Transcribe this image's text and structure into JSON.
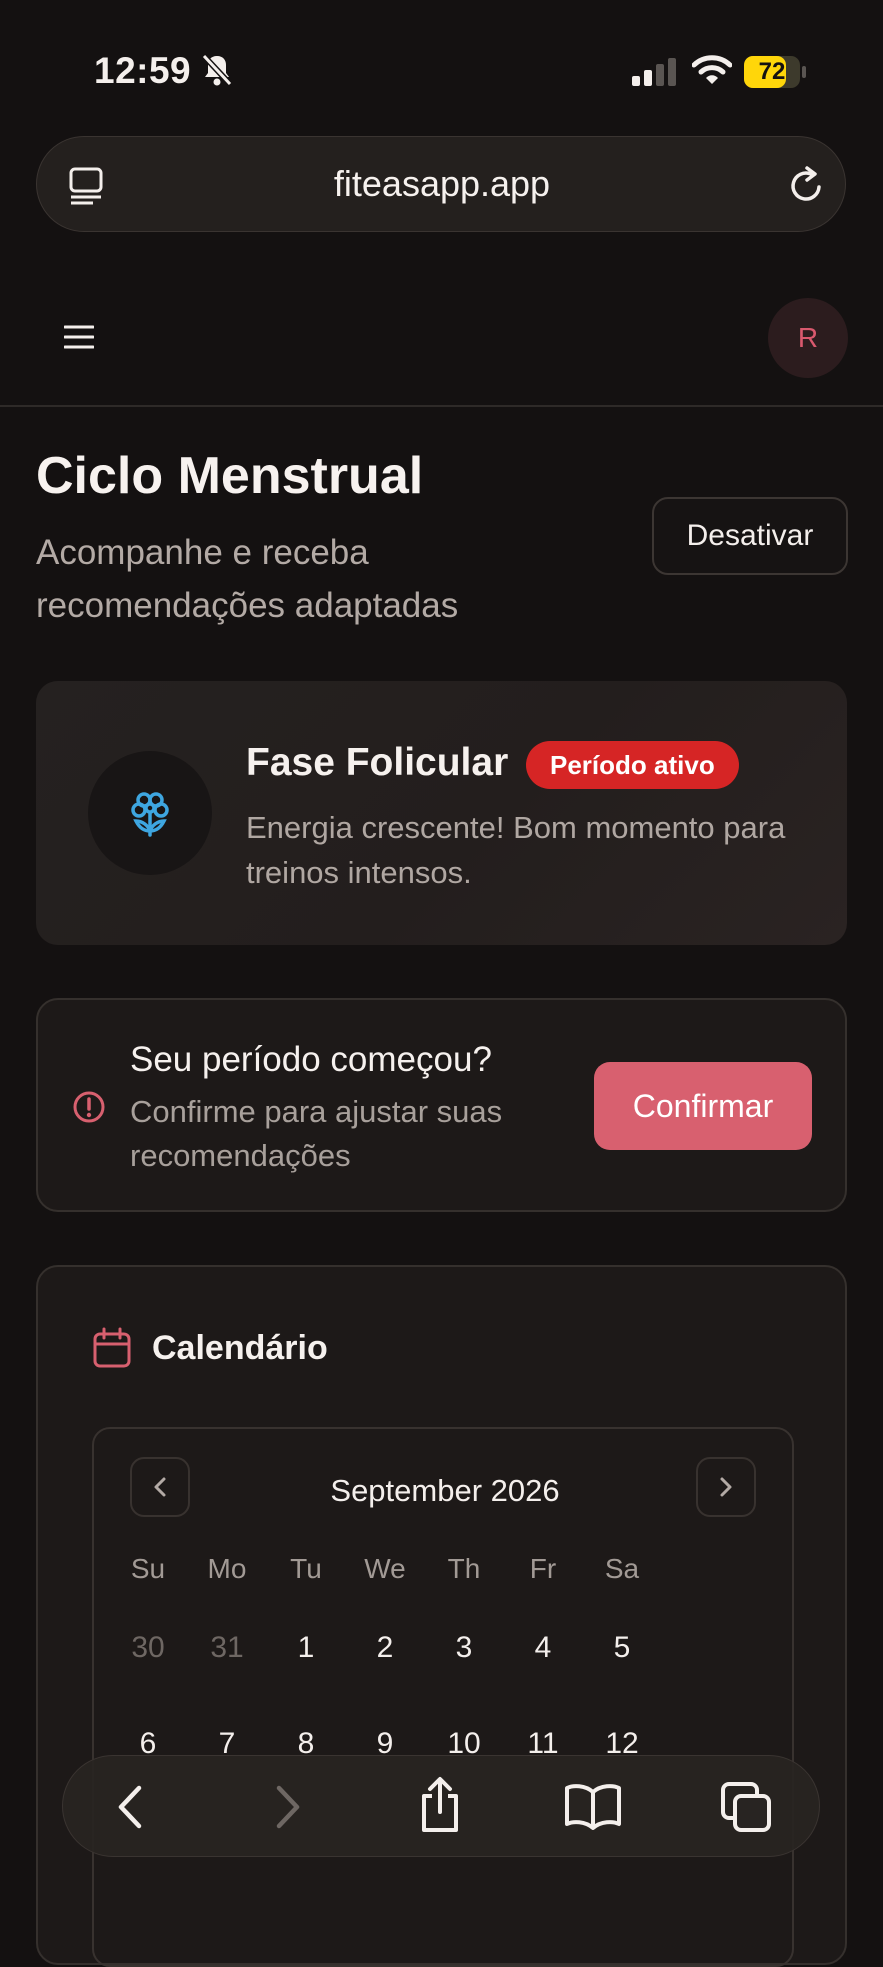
{
  "status_bar": {
    "time": "12:59",
    "battery": "72"
  },
  "browser": {
    "url": "fiteasapp.app"
  },
  "header": {
    "avatar_initial": "R"
  },
  "page": {
    "title": "Ciclo Menstrual",
    "subtitle": "Acompanhe e receba recomendações adaptadas",
    "disable_label": "Desativar"
  },
  "phase_card": {
    "title": "Fase Folicular",
    "badge": "Período ativo",
    "description": "Energia crescente! Bom momento para treinos intensos."
  },
  "period_card": {
    "title": "Seu período começou?",
    "description": "Confirme para ajustar suas recomendações",
    "confirm_label": "Confirmar"
  },
  "calendar": {
    "title": "Calendário",
    "month": "September 2026",
    "weekdays": [
      "Su",
      "Mo",
      "Tu",
      "We",
      "Th",
      "Fr",
      "Sa"
    ],
    "weeks": [
      [
        "30",
        "31",
        "1",
        "2",
        "3",
        "4",
        "5"
      ],
      [
        "6",
        "7",
        "8",
        "9",
        "10",
        "11",
        "12"
      ]
    ],
    "muted_days": [
      "30",
      "31"
    ]
  },
  "colors": {
    "accent": "#d8606f",
    "badge": "#d62525",
    "icon_blue": "#3ea6e0",
    "battery": "#ffd60a"
  }
}
